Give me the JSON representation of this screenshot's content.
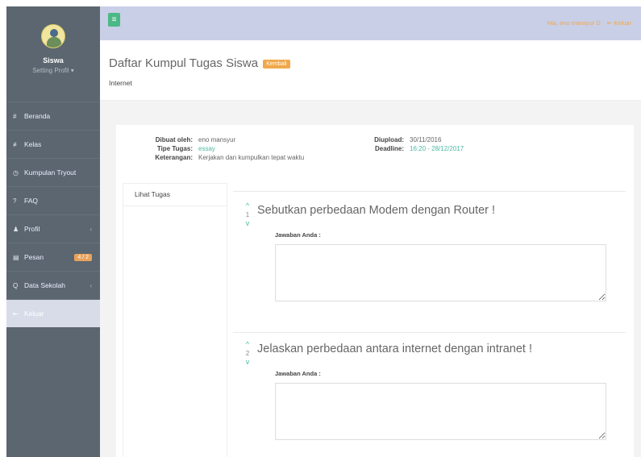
{
  "sidebar": {
    "profile_name": "Siswa",
    "profile_setting": "Setting Profil ▾",
    "items": [
      {
        "label": "Beranda",
        "icon": "#"
      },
      {
        "label": "Kelas",
        "icon": "≢"
      },
      {
        "label": "Kumpulan Tryout",
        "icon": "◷"
      },
      {
        "label": "FAQ",
        "icon": "?"
      },
      {
        "label": "Profil",
        "icon": "♟",
        "chevron": "‹"
      },
      {
        "label": "Pesan",
        "icon": "▤",
        "badge": "4 / 2"
      },
      {
        "label": "Data Sekolah",
        "icon": "Q",
        "chevron": "‹"
      },
      {
        "label": "Keluar",
        "icon": "⇤"
      }
    ]
  },
  "topbar": {
    "toggle": "≡",
    "greeting": "Hai, eno mansyur D",
    "logout": "⇤ Keluar"
  },
  "header": {
    "title": "Daftar Kumpul Tugas Siswa",
    "back_label": "Kembali",
    "subtitle": "Internet"
  },
  "meta": {
    "left": [
      {
        "key": "Dibuat oleh:",
        "value": "eno mansyur"
      },
      {
        "key": "Tipe Tugas:",
        "value": "essay"
      },
      {
        "key": "Keterangan:",
        "value": "Kerjakan dan kumpulkan tepat waktu"
      }
    ],
    "right": [
      {
        "key": "Diupload:",
        "value": "30/11/2016"
      },
      {
        "key": "Deadline:",
        "value": "16:20 - 28/12/2017"
      }
    ]
  },
  "tabs": [
    {
      "label": "Lihat Tugas"
    }
  ],
  "questions": [
    {
      "number": "1",
      "text": "Sebutkan perbedaan Modem dengan Router !",
      "answer_label": "Jawaban Anda :",
      "answer_value": ""
    },
    {
      "number": "2",
      "text": "Jelaskan perbedaan antara internet dengan intranet !",
      "answer_label": "Jawaban Anda :",
      "answer_value": ""
    }
  ],
  "colors": {
    "sidebar_bg": "#5b6670",
    "topbar_bg": "#c9cfe6",
    "accent_green": "#4cb886",
    "accent_orange": "#f0a84b",
    "link_teal": "#4cb8a2"
  }
}
